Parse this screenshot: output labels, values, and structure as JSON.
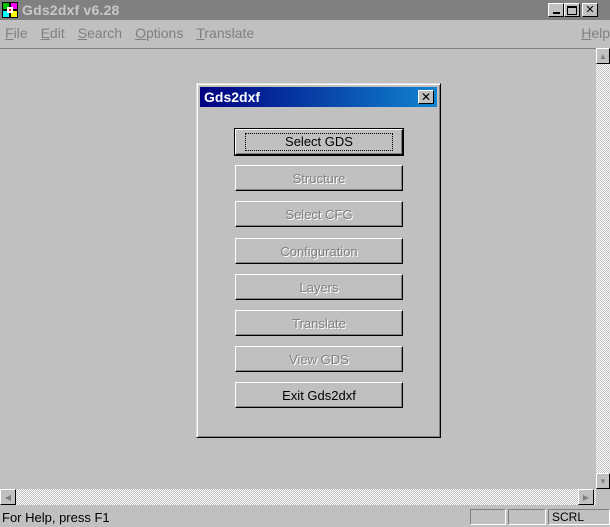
{
  "window": {
    "title": "Gds2dxf v6.28",
    "icon": "app-logo-icon",
    "controls": [
      "minimize-icon",
      "maximize-icon",
      "close-icon"
    ]
  },
  "menubar": {
    "items": [
      {
        "label": "File",
        "mnemonic": "F",
        "rest": "ile"
      },
      {
        "label": "Edit",
        "mnemonic": "E",
        "rest": "dit"
      },
      {
        "label": "Search",
        "mnemonic": "S",
        "rest": "earch"
      },
      {
        "label": "Options",
        "mnemonic": "O",
        "rest": "ptions"
      },
      {
        "label": "Translate",
        "mnemonic": "T",
        "rest": "ranslate"
      }
    ],
    "help": {
      "label": "Help",
      "mnemonic": "H",
      "rest": "elp"
    }
  },
  "dialog": {
    "title": "Gds2dxf",
    "close_icon": "close-icon",
    "buttons": [
      {
        "label": "Select GDS",
        "enabled": true,
        "default": true
      },
      {
        "label": "Structure",
        "enabled": false
      },
      {
        "label": "Select CFG",
        "enabled": false
      },
      {
        "label": "Configuration",
        "enabled": false
      },
      {
        "label": "Layers",
        "enabled": false
      },
      {
        "label": "Translate",
        "enabled": false
      },
      {
        "label": "View GDS",
        "enabled": false
      },
      {
        "label": "Exit Gds2dxf",
        "enabled": true
      }
    ]
  },
  "statusbar": {
    "text": "For Help, press F1",
    "indicators": [
      "",
      "",
      "SCRL"
    ]
  },
  "colors": {
    "face": "#c0c0c0",
    "inactive_title": "#808080",
    "active_title_start": "#000080",
    "active_title_end": "#1084d0"
  }
}
